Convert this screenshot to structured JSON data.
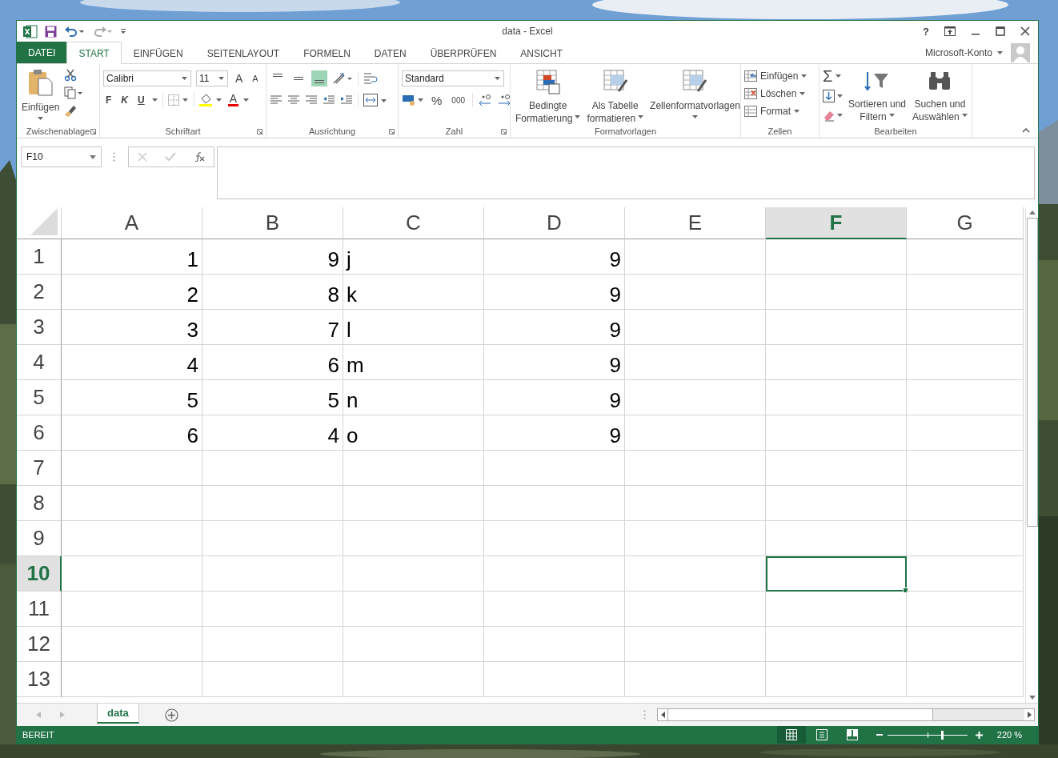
{
  "window": {
    "title": "data - Excel",
    "help": "?"
  },
  "ribbon_tabs": [
    {
      "label": "DATEI",
      "kind": "file",
      "selected": false
    },
    {
      "label": "START",
      "kind": "tab",
      "selected": true
    },
    {
      "label": "EINFÜGEN",
      "kind": "tab",
      "selected": false
    },
    {
      "label": "SEITENLAYOUT",
      "kind": "tab",
      "selected": false
    },
    {
      "label": "FORMELN",
      "kind": "tab",
      "selected": false
    },
    {
      "label": "DATEN",
      "kind": "tab",
      "selected": false
    },
    {
      "label": "ÜBERPRÜFEN",
      "kind": "tab",
      "selected": false
    },
    {
      "label": "ANSICHT",
      "kind": "tab",
      "selected": false
    }
  ],
  "account": {
    "label": "Microsoft-Konto"
  },
  "ribbon": {
    "clipboard": {
      "label": "Zwischenablage",
      "paste": "Einfügen"
    },
    "font": {
      "label": "Schriftart",
      "font_name": "Calibri",
      "font_size": "11",
      "grow": "A",
      "shrink": "A",
      "bold": "F",
      "italic": "K",
      "underline": "U",
      "font_color": "A"
    },
    "alignment": {
      "label": "Ausrichtung",
      "vertical_align": [
        {
          "selected": false
        },
        {
          "selected": false
        },
        {
          "selected": true
        }
      ]
    },
    "number": {
      "label": "Zahl",
      "format": "Standard",
      "percent": "%",
      "thousands": "000"
    },
    "styles": {
      "label": "Formatvorlagen",
      "buttons": [
        [
          "Bedingte",
          "Formatierung"
        ],
        [
          "Als Tabelle",
          "formatieren"
        ],
        [
          "Zellenformatvorlagen"
        ]
      ]
    },
    "cells": {
      "label": "Zellen",
      "buttons": [
        "Einfügen",
        "Löschen",
        "Format"
      ]
    },
    "editing": {
      "label": "Bearbeiten",
      "autosum": "Σ",
      "buttons": [
        [
          "Sortieren und",
          "Filtern"
        ],
        [
          "Suchen und",
          "Auswählen"
        ]
      ]
    }
  },
  "formula_bar": {
    "name_box": "F10"
  },
  "sheet": {
    "columns": [
      {
        "label": "A",
        "selected": false
      },
      {
        "label": "B",
        "selected": false
      },
      {
        "label": "C",
        "selected": false
      },
      {
        "label": "D",
        "selected": false
      },
      {
        "label": "E",
        "selected": false
      },
      {
        "label": "F",
        "selected": true
      },
      {
        "label": "G",
        "selected": false
      }
    ],
    "rows": [
      {
        "label": "1",
        "selected": false,
        "cells": [
          {
            "value": "1",
            "kind": "number"
          },
          {
            "value": "9",
            "kind": "number"
          },
          {
            "value": "j",
            "kind": "text"
          },
          {
            "value": "9",
            "kind": "number"
          }
        ]
      },
      {
        "label": "2",
        "selected": false,
        "cells": [
          {
            "value": "2",
            "kind": "number"
          },
          {
            "value": "8",
            "kind": "number"
          },
          {
            "value": "k",
            "kind": "text"
          },
          {
            "value": "9",
            "kind": "number"
          }
        ]
      },
      {
        "label": "3",
        "selected": false,
        "cells": [
          {
            "value": "3",
            "kind": "number"
          },
          {
            "value": "7",
            "kind": "number"
          },
          {
            "value": "l",
            "kind": "text"
          },
          {
            "value": "9",
            "kind": "number"
          }
        ]
      },
      {
        "label": "4",
        "selected": false,
        "cells": [
          {
            "value": "4",
            "kind": "number"
          },
          {
            "value": "6",
            "kind": "number"
          },
          {
            "value": "m",
            "kind": "text"
          },
          {
            "value": "9",
            "kind": "number"
          }
        ]
      },
      {
        "label": "5",
        "selected": false,
        "cells": [
          {
            "value": "5",
            "kind": "number"
          },
          {
            "value": "5",
            "kind": "number"
          },
          {
            "value": "n",
            "kind": "text"
          },
          {
            "value": "9",
            "kind": "number"
          }
        ]
      },
      {
        "label": "6",
        "selected": false,
        "cells": [
          {
            "value": "6",
            "kind": "number"
          },
          {
            "value": "4",
            "kind": "number"
          },
          {
            "value": "o",
            "kind": "text"
          },
          {
            "value": "9",
            "kind": "number"
          }
        ]
      },
      {
        "label": "7",
        "selected": false,
        "cells": []
      },
      {
        "label": "8",
        "selected": false,
        "cells": []
      },
      {
        "label": "9",
        "selected": false,
        "cells": []
      },
      {
        "label": "10",
        "selected": true,
        "cells": []
      },
      {
        "label": "11",
        "selected": false,
        "cells": []
      },
      {
        "label": "12",
        "selected": false,
        "cells": []
      },
      {
        "label": "13",
        "selected": false,
        "cells": []
      }
    ]
  },
  "sheet_tabs": [
    {
      "label": "data",
      "selected": true
    }
  ],
  "status_bar": {
    "status": "BEREIT",
    "views": [
      {
        "selected": true
      },
      {
        "selected": false
      },
      {
        "selected": false
      }
    ],
    "zoom_slider": {
      "level": 0.69
    },
    "zoom": "220 %"
  }
}
